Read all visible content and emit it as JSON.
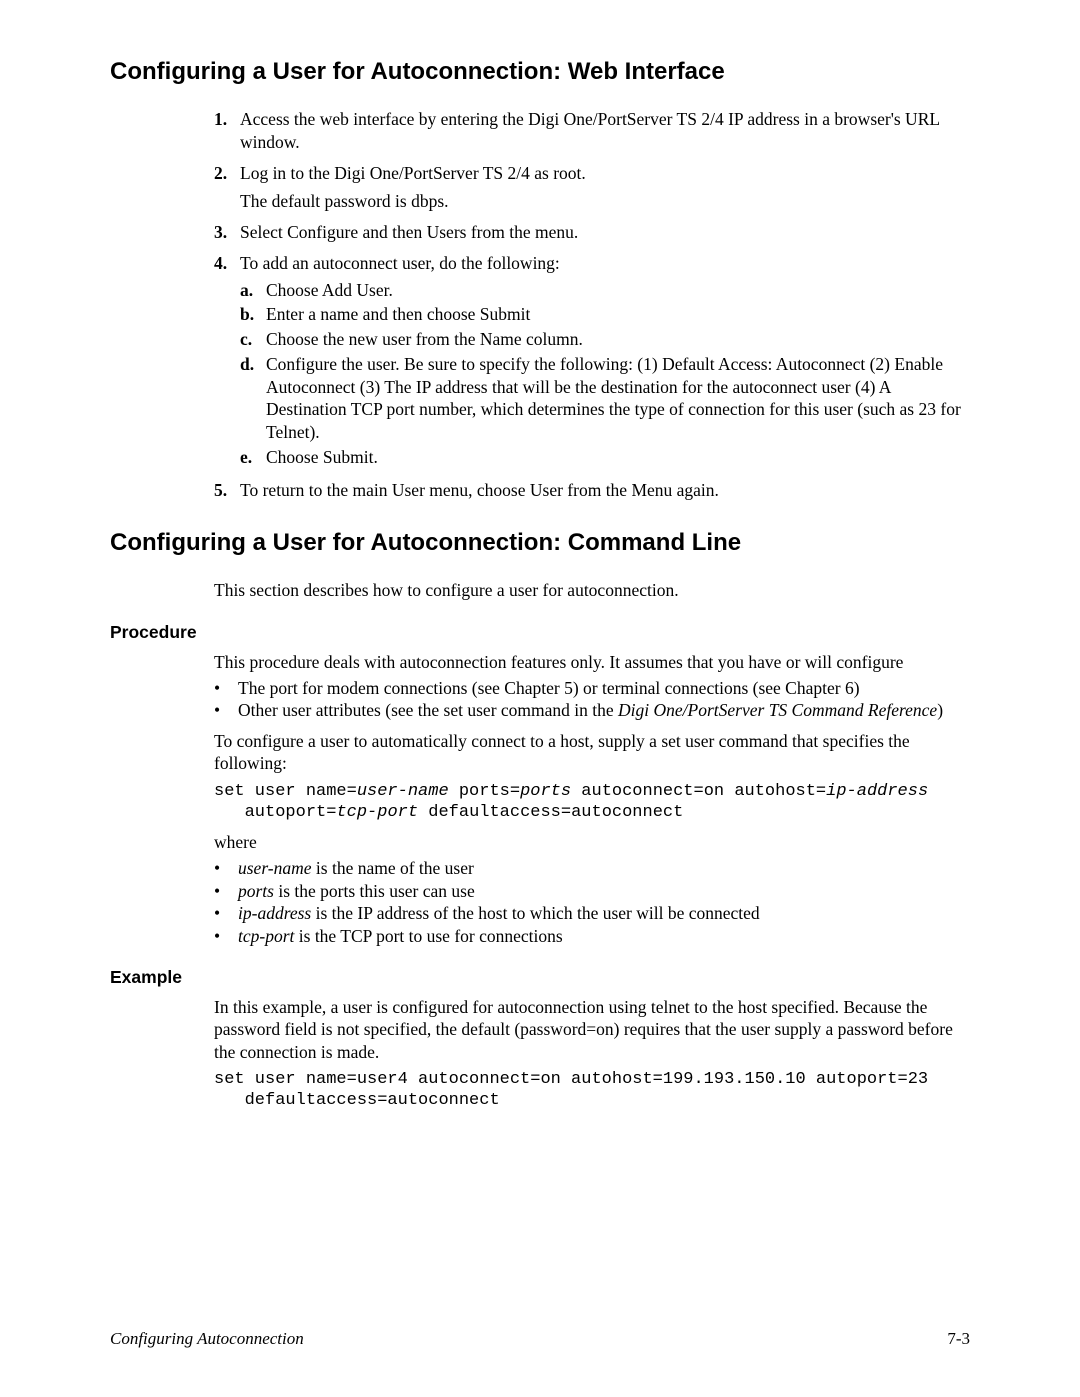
{
  "section1": {
    "title": "Configuring a User for Autoconnection: Web Interface",
    "steps": [
      {
        "num": "1.",
        "text": "Access the web interface by entering the Digi One/PortServer TS 2/4 IP address in a browser's URL window."
      },
      {
        "num": "2.",
        "text": "Log in to the Digi One/PortServer TS 2/4 as root.",
        "extra": "The default password is dbps."
      },
      {
        "num": "3.",
        "text": "Select Configure and then Users from the menu."
      },
      {
        "num": "4.",
        "text": "To add an autoconnect user, do the following:",
        "sub": [
          {
            "num": "a.",
            "text": "Choose Add User."
          },
          {
            "num": "b.",
            "text": "Enter a name and then choose Submit"
          },
          {
            "num": "c.",
            "text": "Choose the new user from the Name column."
          },
          {
            "num": "d.",
            "text": "Configure the user. Be sure to specify the following: (1) Default Access: Autoconnect (2) Enable Autoconnect (3) The IP address that will be the destination for the autoconnect user (4) A Destination TCP port number, which determines the type of connection for this user (such as 23 for Telnet)."
          },
          {
            "num": "e.",
            "text": "Choose Submit."
          }
        ]
      },
      {
        "num": "5.",
        "text": "To return to the main User menu, choose User from the Menu again."
      }
    ]
  },
  "section2": {
    "title": "Configuring a User for Autoconnection: Command Line",
    "intro": "This section describes how to configure a user for autoconnection.",
    "procedure": {
      "heading": "Procedure",
      "p1": "This procedure deals with autoconnection features only. It assumes that you have or will configure",
      "bullets1": [
        "The port for modem connections (see Chapter 5) or terminal connections (see Chapter 6)",
        {
          "pre": "Other user attributes (see the set user command in the ",
          "ital": "Digi One/PortServer TS Command Reference",
          "post": ")"
        }
      ],
      "p2": "To configure a user to automatically connect to a host, supply a set user command that specifies the following:",
      "code1_a": "set user name=",
      "code1_b": "user-name",
      "code1_c": " ports=",
      "code1_d": "ports",
      "code1_e": " autoconnect=on autohost=",
      "code1_f": "ip-address",
      "code1_g": "\n   autoport=",
      "code1_h": "tcp-port",
      "code1_i": " defaultaccess=autoconnect",
      "where": "where",
      "bullets2": [
        {
          "ital": "user-name",
          "rest": " is the name of the user"
        },
        {
          "ital": "ports",
          "rest": " is the ports this user can use"
        },
        {
          "ital": "ip-address",
          "rest": " is the IP address of the host to which the user will be connected"
        },
        {
          "ital": "tcp-port",
          "rest": " is the TCP port to use for connections"
        }
      ]
    },
    "example": {
      "heading": "Example",
      "p1": "In this example, a user is configured for autoconnection using telnet to the host specified. Because the password field is not specified, the default (password=on) requires that the user supply a password before the connection is made.",
      "code": "set user name=user4 autoconnect=on autohost=199.193.150.10 autoport=23\n   defaultaccess=autoconnect"
    }
  },
  "footer": {
    "left": "Configuring Autoconnection",
    "right": "7-3"
  }
}
